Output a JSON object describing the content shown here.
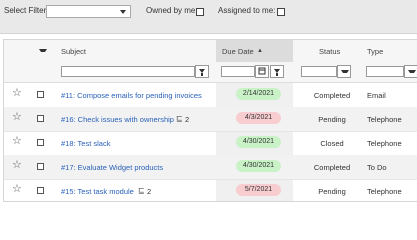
{
  "filters": {
    "select_filter_label": "Select Filter:",
    "owned_by_me_label": "Owned by me:",
    "assigned_to_me_label": "Assigned to me:"
  },
  "columns": {
    "subject": "Subject",
    "due_date": "Due Date",
    "due_sort_arrow": "▲",
    "status": "Status",
    "type": "Type"
  },
  "rows": [
    {
      "subject": "#11: Compose emails for pending invoices",
      "sub_count": "",
      "due": "2/14/2021",
      "due_color": "green",
      "status": "Completed",
      "type": "Email"
    },
    {
      "subject": "#16: Check issues with ownership",
      "sub_count": "2",
      "due": "4/3/2021",
      "due_color": "red",
      "status": "Pending",
      "type": "Telephone"
    },
    {
      "subject": "#18: Test slack",
      "sub_count": "",
      "due": "4/30/2021",
      "due_color": "green",
      "status": "Closed",
      "type": "Telephone"
    },
    {
      "subject": "#17: Evaluate Widget products",
      "sub_count": "",
      "due": "4/30/2021",
      "due_color": "green",
      "status": "Completed",
      "type": "To Do"
    },
    {
      "subject": "#15: Test task module",
      "sub_count": "2",
      "due": "5/7/2021",
      "due_color": "red",
      "status": "Pending",
      "type": "Telephone"
    }
  ],
  "icons": {
    "star": "☆",
    "subtask": "⊑"
  },
  "colors": {
    "link": "#2a62b8",
    "due_green": "#c9f2c7",
    "due_red": "#f8cdd0",
    "alt_row": "#f2f2f2"
  }
}
